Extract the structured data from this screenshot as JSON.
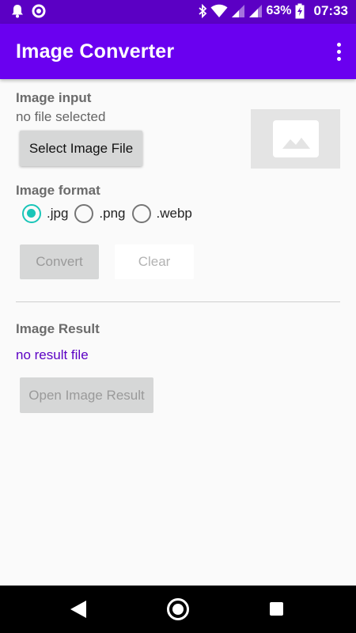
{
  "status_bar": {
    "battery": "63%",
    "time": "07:33",
    "icons": [
      "notification-bell-icon",
      "sync-circle-icon",
      "bluetooth-icon",
      "wifi-icon",
      "signal-icon",
      "signal-icon",
      "battery-charging-icon"
    ]
  },
  "app_bar": {
    "title": "Image Converter",
    "overflow_icon": "more-vert-icon"
  },
  "image_input": {
    "label": "Image input",
    "file_status": "no file selected",
    "select_button": "Select Image File",
    "preview_icon": "image-placeholder-icon"
  },
  "image_format": {
    "label": "Image format",
    "options": [
      ".jpg",
      ".png",
      ".webp"
    ],
    "selected": ".jpg"
  },
  "actions": {
    "convert": "Convert",
    "clear": "Clear"
  },
  "image_result": {
    "label": "Image Result",
    "result_text": "no result file",
    "open_button": "Open Image Result"
  },
  "colors": {
    "status_bar": "#5b00c4",
    "app_bar": "#6a00f0",
    "radio_accent": "#19c5b8",
    "link": "#5b00c4"
  },
  "nav_bar": {
    "icons": [
      "back-icon",
      "home-icon",
      "recents-icon"
    ]
  }
}
